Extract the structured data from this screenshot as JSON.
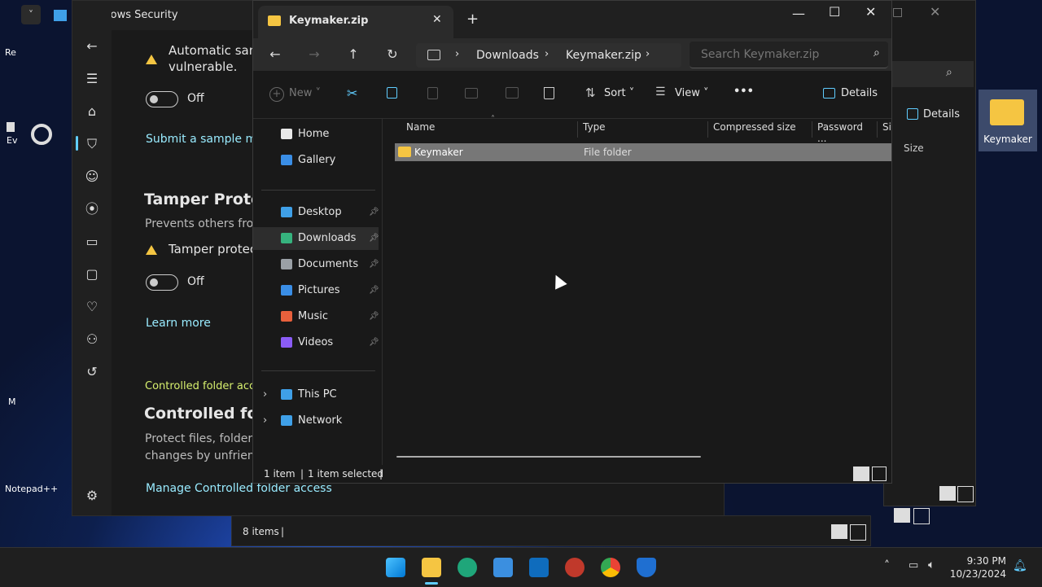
{
  "desktop": {
    "icons": [
      {
        "label": "Re",
        "name": "recycle-bin"
      },
      {
        "label": "Ev",
        "name": "evernote"
      },
      {
        "label": "M",
        "name": "mail"
      },
      {
        "label": "Notepad++",
        "name": "notepad-plus-plus"
      },
      {
        "label": "Keymaker",
        "name": "keymaker-folder"
      }
    ]
  },
  "bg_explorer": {
    "details_label": "Details",
    "size_col": "Size"
  },
  "security": {
    "title": "Windows Security",
    "auto_sample_line1": "Automatic samp",
    "auto_sample_line2": "vulnerable.",
    "auto_sample_toggle": "Off",
    "submit_link": "Submit a sample man",
    "tamper_heading": "Tamper Protect",
    "tamper_desc": "Prevents others from",
    "tamper_warning": "Tamper protecti",
    "tamper_toggle": "Off",
    "learn_more": "Learn more",
    "cfa_link_top": "Controlled folder acce",
    "cfa_heading": "Controlled fold",
    "cfa_desc1": "Protect files, folders,",
    "cfa_desc2": "changes by unfriend",
    "cfa_manage": "Manage Controlled folder access",
    "bg_status": "8 items"
  },
  "explorer": {
    "tab_title": "Keymaker.zip",
    "breadcrumb": [
      "Downloads",
      "Keymaker.zip"
    ],
    "search_placeholder": "Search Keymaker.zip",
    "cmd": {
      "new": "New",
      "sort": "Sort",
      "view": "View",
      "more": "•••",
      "details": "Details"
    },
    "sidebar": [
      {
        "label": "Home",
        "name": "home",
        "color": "#e8e8e8",
        "pin": false
      },
      {
        "label": "Gallery",
        "name": "gallery",
        "color": "#3a8ee6",
        "pin": false
      },
      {
        "label": "Desktop",
        "name": "desktop",
        "color": "#3fa0e8",
        "pin": true
      },
      {
        "label": "Downloads",
        "name": "downloads",
        "color": "#36b37e",
        "pin": true
      },
      {
        "label": "Documents",
        "name": "documents",
        "color": "#9aa0a6",
        "pin": true
      },
      {
        "label": "Pictures",
        "name": "pictures",
        "color": "#3a8ee6",
        "pin": true
      },
      {
        "label": "Music",
        "name": "music",
        "color": "#e8603c",
        "pin": true
      },
      {
        "label": "Videos",
        "name": "videos",
        "color": "#8b5cf6",
        "pin": true
      },
      {
        "label": "This PC",
        "name": "this-pc",
        "color": "#3fa0e8",
        "pin": false
      },
      {
        "label": "Network",
        "name": "network",
        "color": "#3fa0e8",
        "pin": false
      }
    ],
    "columns": [
      "Name",
      "Type",
      "Compressed size",
      "Password ...",
      "Si"
    ],
    "rows": [
      {
        "name": "Keymaker",
        "type": "File folder"
      }
    ],
    "status": {
      "count": "1 item",
      "selected": "1 item selected"
    }
  },
  "taskbar": {
    "time": "9:30 PM",
    "date": "10/23/2024"
  },
  "colors": {
    "accent": "#60cdff",
    "link": "#99ebff",
    "cfa_link": "#d7f06e",
    "folder": "#f5c542",
    "selected_row": "#777777"
  }
}
